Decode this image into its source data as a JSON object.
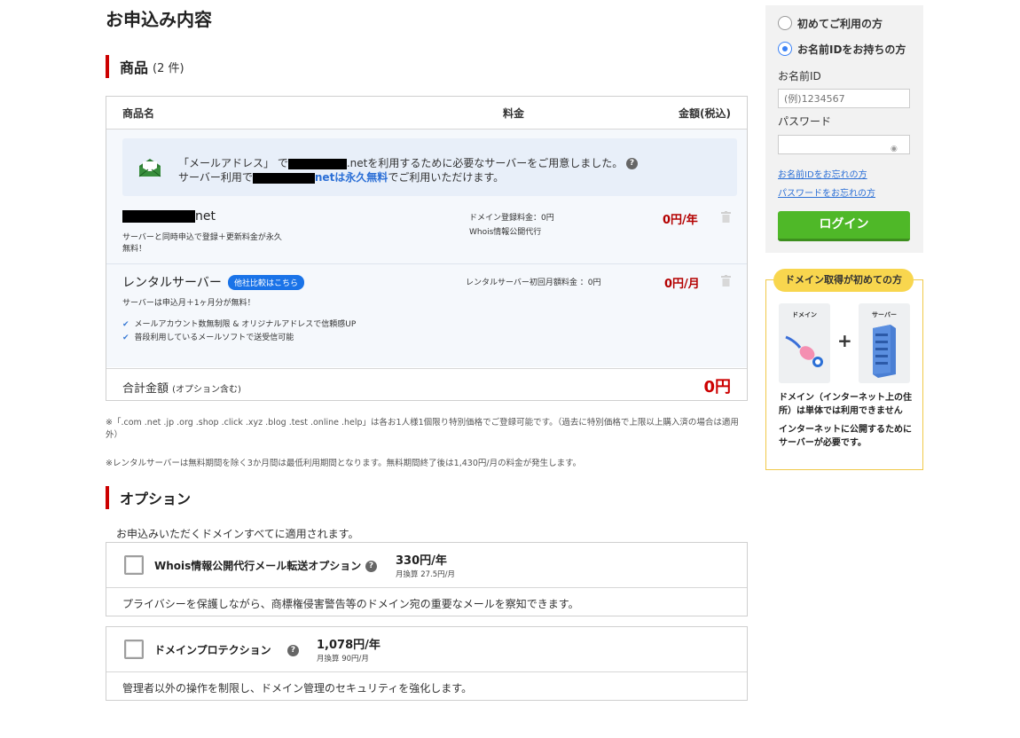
{
  "page": {
    "title": "お申込み内容"
  },
  "products": {
    "heading": "商品",
    "count": "(2 件)",
    "col_name": "商品名",
    "col_fee": "料金",
    "col_amount": "金額(税込)",
    "notice": {
      "line1_pre": "「メールアドレス」 で",
      "line1_suffix": ".netを利用するために必要なサーバーをご用意しました。",
      "line2_pre": "サーバー利用で",
      "line2_link": "netは永久無料",
      "line2_post": "でご利用いただけます。"
    },
    "domain": {
      "name_suffix": "net",
      "desc": "サーバーと同時申込で登録＋更新料金が永久無料！",
      "fee_line1": "ドメイン登録料金：0円",
      "fee_line2": "Whois情報公開代行",
      "price": "0円/年"
    },
    "server": {
      "name": "レンタルサーバー",
      "badge": "他社比較はこちら",
      "fee": "レンタルサーバー初回月額料金 ：0円",
      "price": "0円/月",
      "desc": "サーバーは申込月＋1ヶ月分が無料！",
      "features": [
        "メールアカウント数無制限 & オリジナルアドレスで信頼感UP",
        "普段利用しているメールソフトで送受信可能"
      ]
    },
    "total": {
      "label": "合計金額",
      "label_sub": "(オプション含む)",
      "amount": "0円"
    }
  },
  "notes": {
    "n1": "※「.com .net .jp .org .shop .click .xyz .blog .test .online .help」は各お1人様1個限り特別価格でご登録可能です。（過去に特別価格で上限以上購入済の場合は適用外）",
    "n2": "※レンタルサーバーは無料期間を除く3か月間は最低利用期間となります。無料期間終了後は1,430円/月の料金が発生します。"
  },
  "options": {
    "heading": "オプション",
    "desc": "お申込みいただくドメインすべてに適用されます。",
    "items": [
      {
        "name": "Whois情報公開代行メール転送オプション",
        "price": "330円/年",
        "monthly": "月換算 27.5円/月",
        "text": "プライバシーを保護しながら、商標権侵害警告等のドメイン宛の重要なメールを察知できます。"
      },
      {
        "name": "ドメインプロテクション",
        "price": "1,078円/年",
        "monthly": "月換算 90円/月",
        "text": "管理者以外の操作を制限し、ドメイン管理のセキュリティを強化します。"
      }
    ]
  },
  "login": {
    "radio_first": "初めてご利用の方",
    "radio_member": "お名前IDをお持ちの方",
    "id_label": "お名前ID",
    "id_placeholder": "(例)1234567",
    "pw_label": "パスワード",
    "forgot_id": "お名前IDをお忘れの方",
    "forgot_pw": "パスワードをお忘れの方",
    "button": "ログイン"
  },
  "guide": {
    "tab": "ドメイン取得が初めての方",
    "tile_domain": "ドメイン",
    "tile_server": "サーバー",
    "plus": "+",
    "text1": "ドメイン（インターネット上の住所）は単体では利用できません",
    "text2": "インターネットに公開するためにサーバーが必要です。"
  },
  "colors": {
    "accent_red": "#c00000",
    "link_blue": "#2b6fd6",
    "login_green": "#4fb828",
    "guide_yellow": "#f8d64e"
  }
}
